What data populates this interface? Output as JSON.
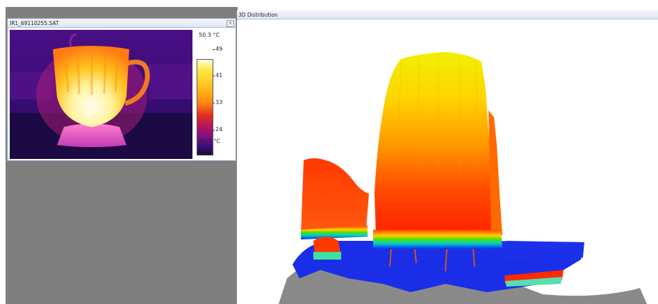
{
  "ir_window": {
    "title": "IR1_69110255.SAT",
    "close_glyph": "×",
    "scale": {
      "max_label": "50.3 °C",
      "min_label": "21.7 °C",
      "ticks": [
        "49",
        "41",
        "33",
        "24"
      ],
      "channel": "IR_1"
    }
  },
  "view3d": {
    "title": "3D Distribution"
  },
  "colors": {
    "workspace": "#7f7f7f",
    "hot": "#ffe94a",
    "mid": "#ff6a10",
    "cold": "#1428e6"
  }
}
